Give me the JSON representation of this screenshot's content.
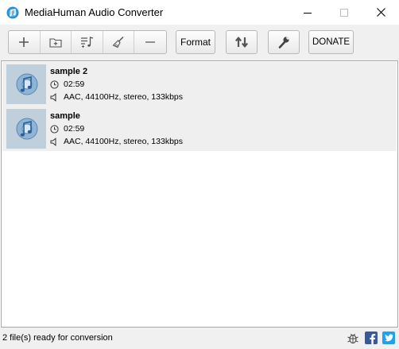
{
  "window": {
    "title": "MediaHuman Audio Converter"
  },
  "toolbar": {
    "add_files": "plus-icon",
    "add_folder": "folder-add-icon",
    "add_playlist": "playlist-add-icon",
    "clear_list": "broom-icon",
    "remove": "minus-icon",
    "format_label": "Format",
    "convert": "convert-arrows-icon",
    "settings": "wrench-icon",
    "donate_label": "DONATE"
  },
  "files": [
    {
      "name": "sample 2",
      "duration": "02:59",
      "format": "AAC, 44100Hz, stereo, 133kbps"
    },
    {
      "name": "sample",
      "duration": "02:59",
      "format": "AAC, 44100Hz, stereo, 133kbps"
    }
  ],
  "status": {
    "text": "2 file(s) ready for conversion"
  },
  "colors": {
    "facebook": "#3b5998",
    "twitter": "#1da1f2",
    "thumb_bg": "#bfcfdc",
    "app_icon": "#2b8fd6"
  }
}
